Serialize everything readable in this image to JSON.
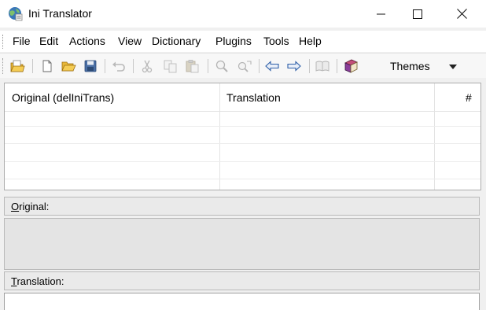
{
  "window": {
    "title": "Ini Translator"
  },
  "menu": {
    "items": [
      "File",
      "Edit",
      "Actions",
      "View",
      "Dictionary",
      "Plugins",
      "Tools",
      "Help"
    ]
  },
  "toolbar": {
    "buttons": [
      "open-project-icon",
      "new-file-icon",
      "open-folder-icon",
      "save-icon",
      "undo-icon",
      "cut-icon",
      "copy-icon",
      "paste-icon",
      "find-icon",
      "replace-icon",
      "previous-arrow-icon",
      "next-arrow-icon",
      "dictionary-icon",
      "book-icon"
    ],
    "themes_label": "Themes"
  },
  "grid": {
    "columns": [
      "Original (delIniTrans)",
      "Translation",
      "#"
    ]
  },
  "original_panel": {
    "label_underlined": "O",
    "label_rest": "riginal:"
  },
  "translation_panel": {
    "label_underlined": "T",
    "label_rest": "ranslation:"
  }
}
